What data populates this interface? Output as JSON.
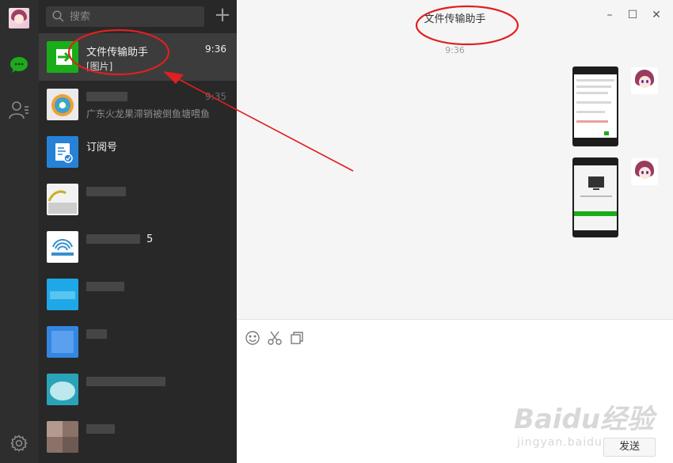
{
  "search": {
    "placeholder": "搜索"
  },
  "chats": [
    {
      "name": "文件传输助手",
      "preview": "[图片]",
      "time": "9:36",
      "active": true
    },
    {
      "name": "",
      "preview": "广东火龙果滞销被倒鱼塘喂鱼",
      "time": "9:35"
    },
    {
      "name": "订阅号",
      "preview": "",
      "time": ""
    },
    {
      "name": "",
      "preview": "",
      "time": ""
    },
    {
      "name": "5",
      "preview": "",
      "time": ""
    },
    {
      "name": "",
      "preview": "",
      "time": ""
    },
    {
      "name": "",
      "preview": "",
      "time": ""
    },
    {
      "name": "",
      "preview": "",
      "time": ""
    },
    {
      "name": "",
      "preview": "",
      "time": ""
    }
  ],
  "window": {
    "title": "文件传输助手",
    "minimize": "–",
    "maximize": "☐",
    "close": "✕"
  },
  "conversation": {
    "timestamp": "9:36"
  },
  "input": {
    "send_label": "发送"
  },
  "watermark": {
    "brand": "Baidu经验",
    "url": "jingyan.baidu.com"
  },
  "colors": {
    "sidebar_bg": "#2e2e2e",
    "chatlist_bg": "#282828",
    "active_item_bg": "#3c3c3c",
    "wechat_green": "#1aad19",
    "annotation_red": "#e02020"
  }
}
